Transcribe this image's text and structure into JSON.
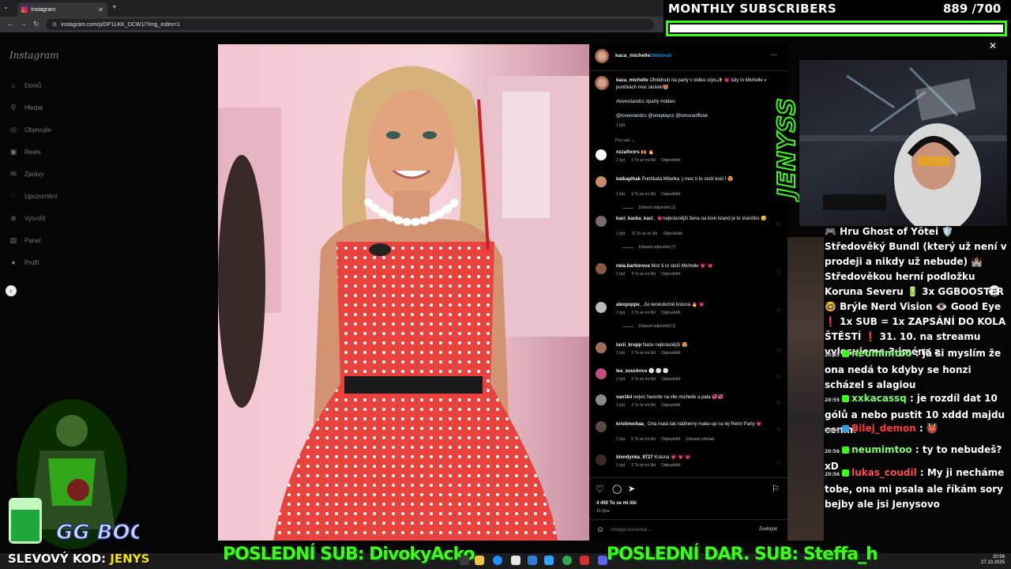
{
  "browser": {
    "tab_title": "Instagram",
    "url": "instagram.com/p/DP1LKK_DCW1/?img_index=1"
  },
  "sidebar": {
    "logo": "Instagram",
    "items": [
      {
        "label": "Domů",
        "icon": "home-icon"
      },
      {
        "label": "Hledat",
        "icon": "search-icon"
      },
      {
        "label": "Objevujte",
        "icon": "compass-icon"
      },
      {
        "label": "Reels",
        "icon": "reels-icon"
      },
      {
        "label": "Zprávy",
        "icon": "messages-icon"
      },
      {
        "label": "Upozornění",
        "icon": "heart-icon"
      },
      {
        "label": "Vytvořit",
        "icon": "plus-icon"
      },
      {
        "label": "Panel",
        "icon": "dashboard-icon"
      },
      {
        "label": "Profil",
        "icon": "profile-icon"
      }
    ]
  },
  "post": {
    "author": "kaca_michelle",
    "follow": "Sledovat",
    "more": "···",
    "caption_user": "kaca_michelle",
    "caption_text": "Ohlédnutí na party v oldies stylu✨ 💗 kdy to Michelle v puntíkách moc slušelo😻",
    "hashtags": "#loveislandcs #party #oldies",
    "mentions": "@loveislandcs @oneplaycz @tvnovaofficial",
    "caption_time": "1 týd.",
    "for_you": "Pro vás ⌄",
    "comments": [
      {
        "user": "nzzafloors",
        "text": "🙌 🔥",
        "time": "1 týd.",
        "likes": "2 To se mi líbí",
        "reply": "Odpovědět",
        "replies": ""
      },
      {
        "user": "katkaplhak",
        "text": "Puntíkatá Mišelka :) moc ti to sluší koči ! 😍",
        "time": "1 týd.",
        "likes": "9 To se mi líbí",
        "reply": "Odpovědět",
        "replies": "Zobrazit odpovědi (1)"
      },
      {
        "user": "kaci_kacka_kaci_",
        "text": "💗nejkrásnější žena na love Island je to sluníčko 😊",
        "time": "1 týd.",
        "likes": "11 To se mi líbí",
        "reply": "Odpovědět",
        "replies": "Zobrazit odpovědi (7)"
      },
      {
        "user": "nela.bartonova",
        "text": "Moc ti to sluší Michelle 💗 💗",
        "time": "1 týd.",
        "likes": "4 To se mi líbí",
        "reply": "Odpovědět",
        "replies": ""
      },
      {
        "user": "alexpoppe_",
        "text": "Jsi neskutečně krásná 🔥 💗",
        "time": "1 týd.",
        "likes": "2 To se mi líbí",
        "reply": "Odpovědět",
        "replies": "Zobrazit odpovědi (1)"
      },
      {
        "user": "lucii_krupp",
        "text": "Naše nejkrásnější 😍",
        "time": "1 týd.",
        "likes": "2 To se mi líbí",
        "reply": "Odpovědět",
        "replies": ""
      },
      {
        "user": "lea_souckova",
        "text": "⚪ ⚪ ⚪",
        "time": "1 týd.",
        "likes": "2 To se mi líbí",
        "reply": "Odpovědět",
        "replies": ""
      },
      {
        "user": "van1kii",
        "text": "nejvic favorite na vile michelle a pata 💞💞",
        "time": "1 týd.",
        "likes": "2 To se mi líbí",
        "reply": "Odpovědět",
        "replies": ""
      },
      {
        "user": "kristinockaa_",
        "text": "Ona mala tak nádherný make-up na tej Retro Party 💗",
        "time": "1 týd.",
        "likes": "5 To se mi líbí",
        "reply": "Odpovědět",
        "extra": "Zobrazit překlad",
        "replies": ""
      },
      {
        "user": "blondynka_9727",
        "text": "Krásná 💗 💗 💗",
        "time": "1 týd.",
        "likes": "2 To se mi líbí",
        "reply": "Odpovědět",
        "replies": ""
      }
    ],
    "like_count": "4 450 To se mi líbí",
    "date": "15 října",
    "comment_placeholder": "Přidejte komentář...",
    "publish": "Zveřejnit"
  },
  "stream": {
    "subs_title": "MONTHLY SUBSCRIBERS",
    "subs_count": "889 /700",
    "subs_progress": 1.0,
    "jenyss_logo": "JENYSS",
    "chat": [
      {
        "ts": "",
        "user": "",
        "text": "🎮 Hru Ghost of Yōtei 🛡️ Středověký Bundl (který už není v prodeji a nikdy už nebude) 🏰 Středověkou herní podložku Koruna Severu 🔋 3x GGBOOSTER 🤓 Brýle Nerd Vision 👁️ Good Eye ❗ 1x SUB = 1x ZAPSÁNÍ DO KOLA ŠTĚSTÍ ❗ 31. 10. na streamu vylosujeme 3 jména a",
        "color": "#ffffff"
      },
      {
        "ts": "20:55",
        "user": "neumimtoo",
        "text": ": já si myslím že ona nedá to kdyby se honzi scházel s alagiou",
        "color": "#7dff6a"
      },
      {
        "ts": "20:55",
        "user": "xxkacassq",
        "text": ": je rozdíl dat 10 gólů a nebo pustit 10 xddd majdu cením",
        "color": "#7dff6a"
      },
      {
        "ts": "20:56",
        "user": "Bilej_demon",
        "text": ": 👹",
        "color": "#ff3b3b"
      },
      {
        "ts": "20:56",
        "user": "neumimtoo",
        "text": ": ty to nebudeš? xD",
        "color": "#7dff6a"
      },
      {
        "ts": "20:56",
        "user": "lukas_coudil",
        "text": ": My ji necháme tobe, ona mi psala ale říkám sory bejby ale jsi Jenysovo",
        "color": "#ff4d4d"
      }
    ],
    "slevovy_label": "SLEVOVÝ KOD:",
    "slevovy_code": "JENYS",
    "last_sub": "POSLEDNÍ SUB: DivokyAcko",
    "last_dar": "POSLEDNÍ DAR. SUB: Steffa_h",
    "ggbooster": "GG BOOSTER"
  },
  "taskbar": {
    "time": "20:56",
    "date": "27.10.2025"
  },
  "colors": {
    "accent_green": "#39ff14",
    "ig_link": "#e0f1ff",
    "follow_blue": "#0095f6"
  }
}
